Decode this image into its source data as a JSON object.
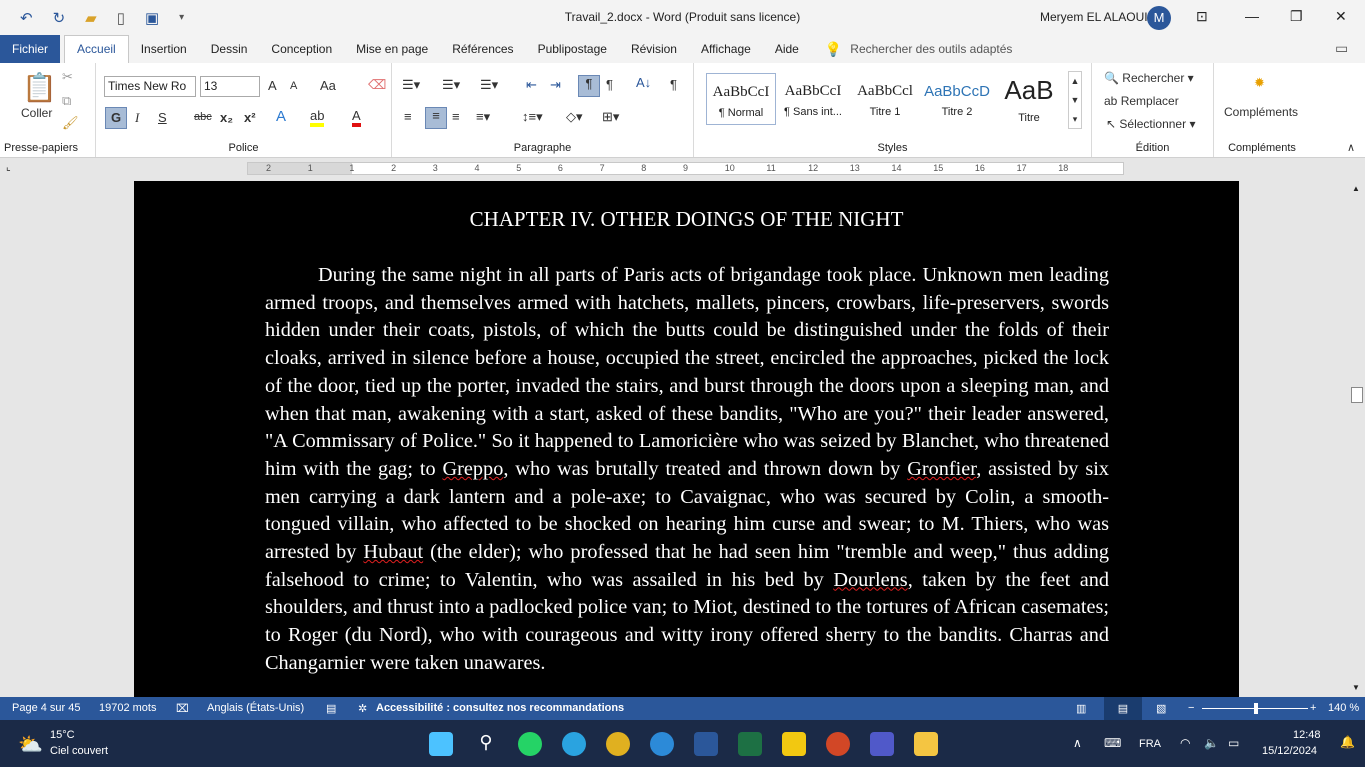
{
  "titlebar": {
    "title": "Travail_2.docx  -  Word (Produit sans licence)",
    "user": "Meryem EL ALAOUI",
    "avatar": "M",
    "icons": [
      "undo-icon",
      "redo-icon",
      "open-icon",
      "new-icon",
      "save-icon",
      "customize-icon"
    ]
  },
  "tabs": [
    {
      "label": "Fichier"
    },
    {
      "label": "Accueil"
    },
    {
      "label": "Insertion"
    },
    {
      "label": "Dessin"
    },
    {
      "label": "Conception"
    },
    {
      "label": "Mise en page"
    },
    {
      "label": "Références"
    },
    {
      "label": "Publipostage"
    },
    {
      "label": "Révision"
    },
    {
      "label": "Affichage"
    },
    {
      "label": "Aide"
    }
  ],
  "search": {
    "placeholder": "Rechercher des outils adaptés"
  },
  "ribbon": {
    "clipboard": {
      "label": "Presse-papiers",
      "paste": "Coller"
    },
    "font": {
      "label": "Police",
      "name": "Times New Ro",
      "size": "13",
      "bold": "G",
      "italic": "I",
      "underline": "S",
      "strike": "abc",
      "sub": "x₂",
      "sup": "x²",
      "case": "Aa",
      "grow": "A",
      "shrink": "A",
      "font_color": "#e01010",
      "highlight": "#ffff00"
    },
    "paragraph": {
      "label": "Paragraphe"
    },
    "styles": {
      "label": "Styles",
      "items": [
        {
          "sample": "AaBbCcI",
          "name": "¶ Normal"
        },
        {
          "sample": "AaBbCcI",
          "name": "¶ Sans int..."
        },
        {
          "sample": "AaBbCcl",
          "name": "Titre 1"
        },
        {
          "sample": "AaBbCcD",
          "name": "Titre 2"
        },
        {
          "sample": "AaB",
          "name": "Titre"
        }
      ]
    },
    "editing": {
      "label": "Édition",
      "find": "Rechercher",
      "replace": "Remplacer",
      "select": "Sélectionner"
    },
    "addins": {
      "label": "Compléments",
      "button": "Compléments"
    }
  },
  "ruler": [
    "2",
    "1",
    "1",
    "2",
    "3",
    "4",
    "5",
    "6",
    "7",
    "8",
    "9",
    "10",
    "11",
    "12",
    "13",
    "14",
    "15",
    "16",
    "17",
    "18"
  ],
  "document": {
    "heading": "CHAPTER IV. OTHER DOINGS OF THE NIGHT",
    "segments": [
      {
        "t": "During the same night in all parts of Paris acts of brigandage took place. Unknown men leading armed troops, and themselves armed with hatchets, mallets, pincers, crowbars, life-preservers, swords hidden under their coats, pistols, of which the butts could be distinguished under the folds of their cloaks, arrived in silence before a house, occupied the street, encircled the approaches, picked the lock of the door, tied up the porter, invaded the stairs, and burst through the doors upon a sleeping man, and when that man, awakening with a start, asked of these bandits, \"Who are you?\" their leader answered, \"A Commissary of Police.\" So it happened to Lamoricière who was seized by Blanchet, who threatened him with the gag; to "
      },
      {
        "t": "Greppo",
        "spell": true
      },
      {
        "t": ", who was brutally treated and thrown down by "
      },
      {
        "t": "Gronfier",
        "spell": true
      },
      {
        "t": ", assisted by six men carrying a dark lantern and a pole-axe; to Cavaignac, who was secured by Colin, a smooth-tongued villain, who affected to be shocked on hearing him curse and swear; to M. Thiers, who was arrested by "
      },
      {
        "t": "Hubaut",
        "spell": true
      },
      {
        "t": " (the elder); who professed that he had seen him \"tremble and weep,\" thus adding falsehood to crime; to Valentin, who was assailed in his bed by "
      },
      {
        "t": "Dourlens",
        "spell": true
      },
      {
        "t": ", taken by the feet and shoulders, and thrust into a padlocked police van; to Miot, destined to the tortures of African casemates; to Roger (du Nord), who with courageous and witty irony offered sherry to the bandits. Charras and Changarnier were taken unawares."
      }
    ]
  },
  "status": {
    "page": "Page 4 sur 45",
    "words": "19702 mots",
    "language": "Anglais (États-Unis)",
    "accessibility": "Accessibilité : consultez nos recommandations",
    "zoom": "140 %",
    "zoom_percent": 140
  },
  "taskbar": {
    "temp": "15°C",
    "weather": "Ciel couvert",
    "lang": "FRA",
    "time": "12:48",
    "date": "15/12/2024",
    "apps": [
      "windows-start-icon",
      "search-icon",
      "whatsapp-icon",
      "telegram-icon",
      "chrome-icon",
      "edge-icon",
      "word-icon",
      "excel-icon",
      "powerbi-icon",
      "powerpoint-icon",
      "teams-icon",
      "file-explorer-icon"
    ]
  },
  "colors": {
    "accent": "#2b579a",
    "page": "#000000",
    "text": "#ffffff",
    "taskbar": "#1b2a47"
  }
}
